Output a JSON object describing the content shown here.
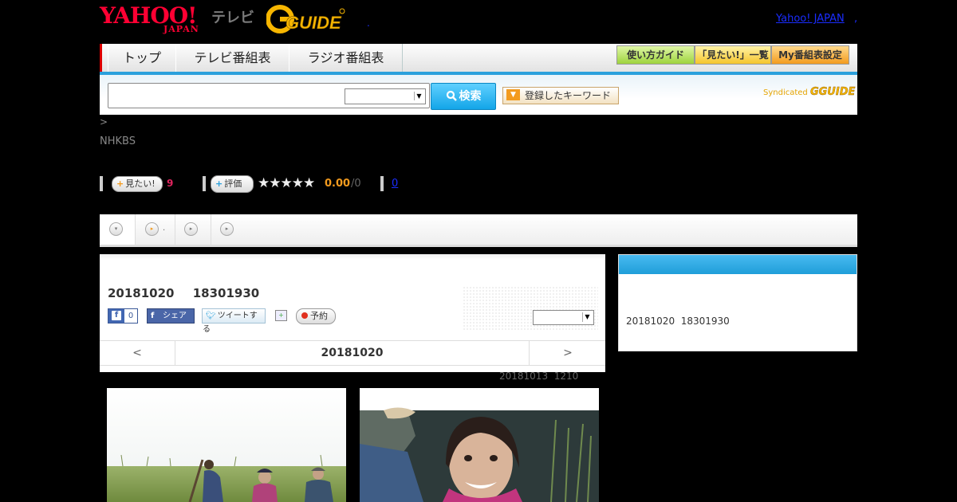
{
  "header": {
    "yahoo_logo": "YAHOO!",
    "yahoo_japan": "JAPAN",
    "tv_label": "テレビ",
    "gguide_logo": "G GUIDE",
    "yahoo_japan_link": "Yahoo! JAPAN",
    "link_sep": ",",
    "dot_sep": "."
  },
  "nav": {
    "tabs": [
      "トップ",
      "テレビ番組表",
      "ラジオ番組表"
    ],
    "buttons": [
      "使い方ガイド",
      "「見たい!」一覧",
      "My番組表設定"
    ]
  },
  "search": {
    "input_value": "",
    "select_value": "",
    "button_label": "検索",
    "keyword_button": "登録したキーワード",
    "syndicated_label": "Syndicated",
    "syndicated_brand": "GUIDE"
  },
  "breadcrumb": ">",
  "channel": "NHKBS",
  "actions": {
    "want_label": "見たい!",
    "want_count": "9",
    "rate_label": "評価",
    "stars": "★★★★★",
    "rating": "0.00",
    "rating_count": "/0",
    "review_count": "0"
  },
  "tabs": [
    {
      "icon": "▾",
      "label": ""
    },
    {
      "icon": "▸",
      "label": "."
    },
    {
      "icon": "▸",
      "label": ""
    },
    {
      "icon": "▸",
      "label": ""
    }
  ],
  "program": {
    "date": "20181020",
    "time": "18301930",
    "fb_count": "0",
    "fb_share": "シェア",
    "tweet": "ツイートする",
    "reserve": "予約",
    "select_value": ""
  },
  "date_nav": {
    "prev": "<",
    "current": "20181020",
    "next": ">"
  },
  "updated": {
    "date": "20181013",
    "time": "1210"
  },
  "side": {
    "date": "20181020",
    "time": "18301930"
  },
  "colors": {
    "accent_blue": "#2aa0dc",
    "yahoo_red": "#ff0033",
    "gguide_yellow": "#f7b600",
    "link_blue": "#1a2dff"
  }
}
